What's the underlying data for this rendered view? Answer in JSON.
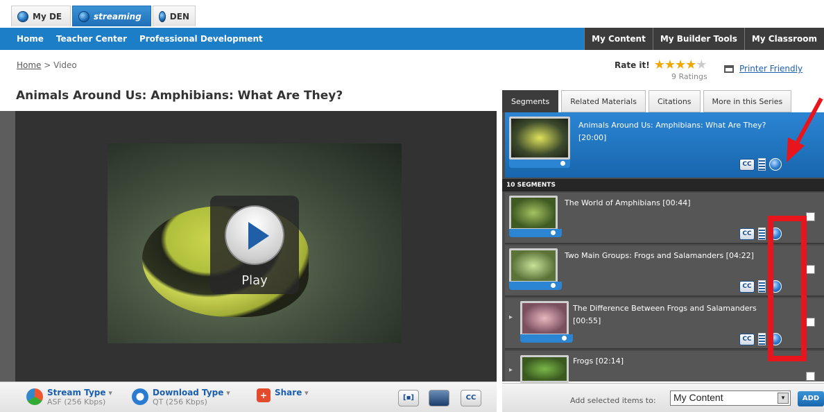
{
  "top_tabs": [
    {
      "label": "My DE"
    },
    {
      "label": "streaming"
    },
    {
      "label": "DEN"
    }
  ],
  "nav": {
    "left": [
      "Home",
      "Teacher Center",
      "Professional Development"
    ],
    "right": [
      "My Content",
      "My Builder Tools",
      "My Classroom"
    ]
  },
  "breadcrumb": {
    "home": "Home",
    "sep": " > ",
    "current": "Video"
  },
  "rating": {
    "label": "Rate it!",
    "stars_filled": 4,
    "stars_total": 5,
    "count_text": "9 Ratings"
  },
  "printer": {
    "label": "Printer Friendly"
  },
  "video": {
    "title": "Animals Around Us: Amphibians: What Are They?",
    "play_label": "Play"
  },
  "bottom_bar": {
    "stream": {
      "label": "Stream Type",
      "caret": "▾",
      "sub": "ASF (256 Kbps)"
    },
    "download": {
      "label": "Download Type",
      "caret": "▾",
      "sub": "QT (256 Kbps)"
    },
    "share": {
      "label": "Share",
      "caret": "▾"
    },
    "cc_label": "CC"
  },
  "panel": {
    "tabs": [
      "Segments",
      "Related Materials",
      "Citations",
      "More in this Series"
    ],
    "main_item": {
      "title": "Animals Around Us: Amphibians: What Are They?",
      "duration": "[20:00]"
    },
    "segment_count": "10 SEGMENTS",
    "segments": [
      {
        "title": "The World of Amphibians [00:44]"
      },
      {
        "title": "Two Main Groups: Frogs and Salamanders [04:22]"
      },
      {
        "title": "The Difference Between Frogs and Salamanders",
        "duration": "[00:55]"
      },
      {
        "title": "Frogs [02:14]"
      }
    ],
    "cc": "CC",
    "add_label": "Add selected items to:",
    "add_select": "My Content",
    "add_button": "ADD"
  },
  "colors": {
    "nav_blue": "#1d7ec8",
    "annotation_red": "#e8151c",
    "star": "#f0a800"
  }
}
